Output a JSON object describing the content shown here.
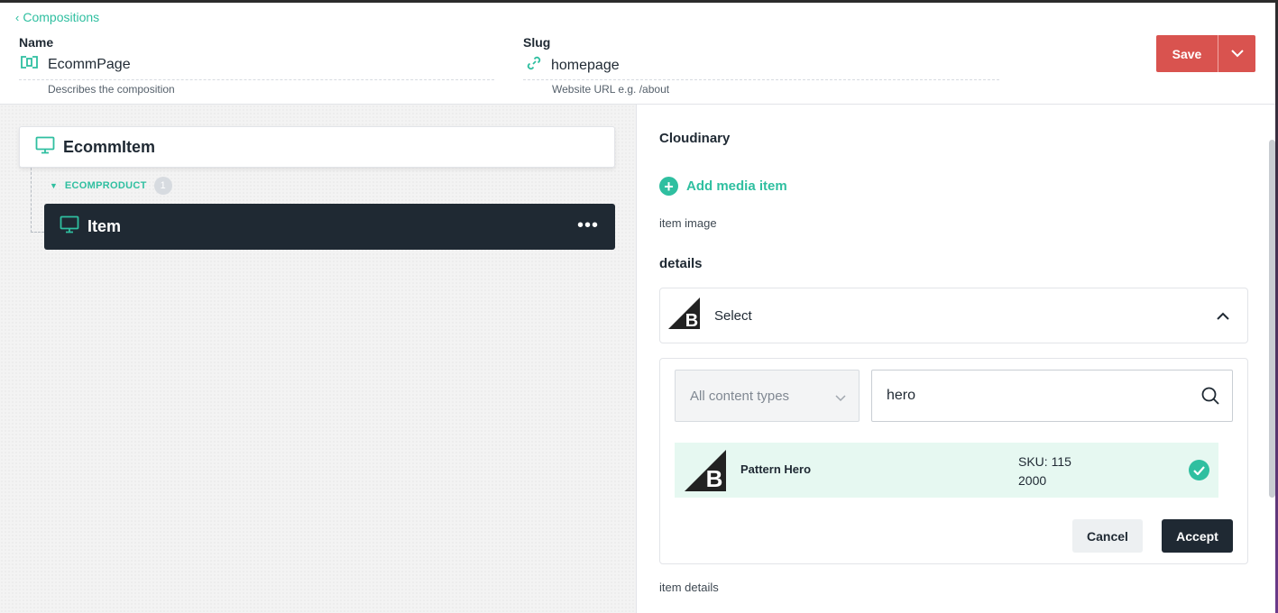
{
  "header": {
    "back_label": "Compositions",
    "name_label": "Name",
    "name_value": "EcommPage",
    "name_help": "Describes the composition",
    "slug_label": "Slug",
    "slug_value": "homepage",
    "slug_help": "Website URL e.g. /about",
    "save_label": "Save"
  },
  "tree": {
    "root_title": "EcommItem",
    "slot_name": "ECOMPRODUCT",
    "slot_count": "1",
    "item_title": "Item"
  },
  "panel": {
    "cloudinary_title": "Cloudinary",
    "add_media_label": "Add media item",
    "item_image_caption": "item image",
    "details_title": "details",
    "select_label": "Select",
    "type_select_value": "All content types",
    "search_value": "hero",
    "result": {
      "name": "Pattern Hero",
      "sku": "SKU: 115 2000",
      "selected": true
    },
    "cancel_label": "Cancel",
    "accept_label": "Accept",
    "item_details_caption": "item details"
  },
  "colors": {
    "accent": "#2fbfa0",
    "save": "#d9534f",
    "dark": "#1f2933",
    "selected_row": "#e6f8f1"
  },
  "icons": {
    "composition": "composition-icon",
    "slug": "link-icon",
    "component": "monitor-icon",
    "brand": "bigcommerce-logo-icon",
    "search": "search-icon",
    "check": "check-circle-icon"
  }
}
